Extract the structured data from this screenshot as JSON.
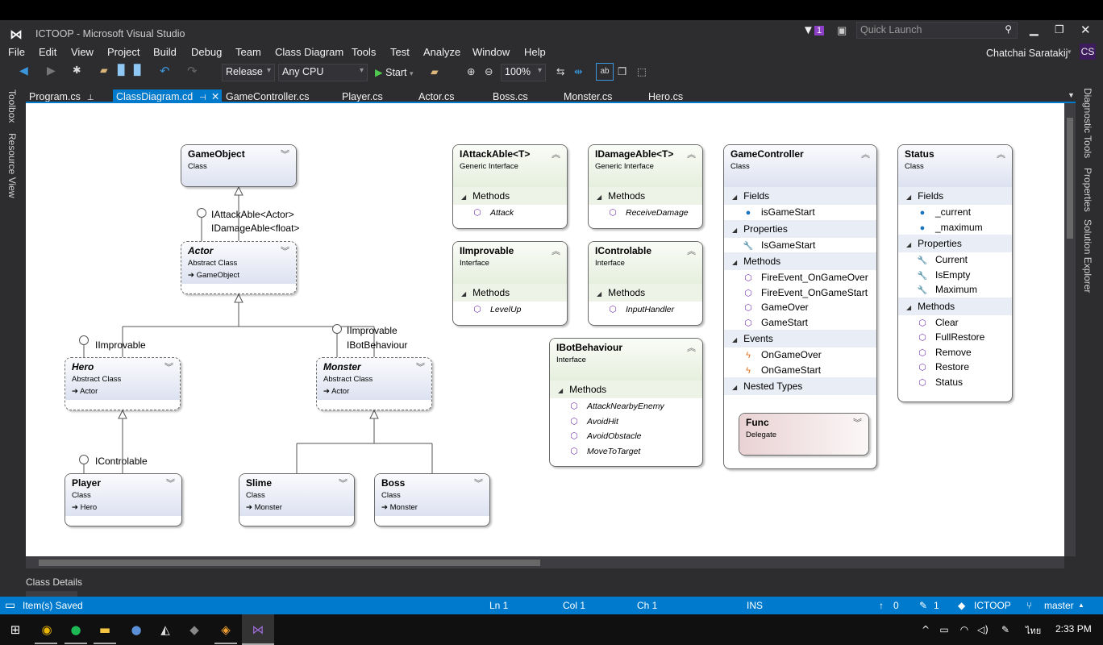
{
  "window": {
    "title": "ICTOOP - Microsoft Visual Studio",
    "notification_count": "1",
    "quick_launch_placeholder": "Quick Launch",
    "user_name": "Chatchai Saratakij",
    "user_initials": "CS"
  },
  "menu": [
    "File",
    "Edit",
    "View",
    "Project",
    "Build",
    "Debug",
    "Team",
    "Class Diagram",
    "Tools",
    "Test",
    "Analyze",
    "Window",
    "Help"
  ],
  "toolbar": {
    "configuration": "Release",
    "platform": "Any CPU",
    "start_label": "Start",
    "zoom": "100%"
  },
  "tabs": [
    {
      "label": "Program.cs",
      "pinned": true
    },
    {
      "label": "ClassDiagram.cd",
      "active": true
    },
    {
      "label": "GameController.cs"
    },
    {
      "label": "Player.cs"
    },
    {
      "label": "Actor.cs"
    },
    {
      "label": "Boss.cs"
    },
    {
      "label": "Monster.cs"
    },
    {
      "label": "Hero.cs"
    }
  ],
  "left_panels": [
    "Toolbox",
    "Resource View"
  ],
  "right_panels": [
    "Diagnostic Tools",
    "Properties",
    "Solution Explorer"
  ],
  "diagram": {
    "classes": [
      {
        "name": "GameObject",
        "kind": "Class",
        "style": "class",
        "chevron": "down"
      },
      {
        "name": "Actor",
        "kind": "Abstract Class",
        "base": "GameObject",
        "style": "abstract",
        "chevron": "down"
      },
      {
        "name": "Hero",
        "kind": "Abstract Class",
        "base": "Actor",
        "style": "abstract",
        "chevron": "down"
      },
      {
        "name": "Monster",
        "kind": "Abstract Class",
        "base": "Actor",
        "style": "abstract",
        "chevron": "down"
      },
      {
        "name": "Player",
        "kind": "Class",
        "base": "Hero",
        "style": "class",
        "chevron": "down"
      },
      {
        "name": "Slime",
        "kind": "Class",
        "base": "Monster",
        "style": "class",
        "chevron": "down"
      },
      {
        "name": "Boss",
        "kind": "Class",
        "base": "Monster",
        "style": "class",
        "chevron": "down"
      },
      {
        "name": "IAttackAble<T>",
        "kind": "Generic Interface",
        "style": "interface",
        "chevron": "up",
        "sections": [
          {
            "title": "Methods",
            "items": [
              {
                "name": "Attack",
                "icon": "method"
              }
            ]
          }
        ]
      },
      {
        "name": "IDamageAble<T>",
        "kind": "Generic Interface",
        "style": "interface",
        "chevron": "up",
        "sections": [
          {
            "title": "Methods",
            "items": [
              {
                "name": "ReceiveDamage",
                "icon": "method"
              }
            ]
          }
        ]
      },
      {
        "name": "IImprovable",
        "kind": "Interface",
        "style": "interface",
        "chevron": "up",
        "sections": [
          {
            "title": "Methods",
            "items": [
              {
                "name": "LevelUp",
                "icon": "method"
              }
            ]
          }
        ]
      },
      {
        "name": "IControlable",
        "kind": "Interface",
        "style": "interface",
        "chevron": "up",
        "sections": [
          {
            "title": "Methods",
            "items": [
              {
                "name": "InputHandler",
                "icon": "method"
              }
            ]
          }
        ]
      },
      {
        "name": "IBotBehaviour",
        "kind": "Interface",
        "style": "interface",
        "chevron": "up",
        "sections": [
          {
            "title": "Methods",
            "items": [
              {
                "name": "AttackNearbyEnemy",
                "icon": "method"
              },
              {
                "name": "AvoidHit",
                "icon": "method"
              },
              {
                "name": "AvoidObstacle",
                "icon": "method"
              },
              {
                "name": "MoveToTarget",
                "icon": "method"
              }
            ]
          }
        ]
      },
      {
        "name": "GameController",
        "kind": "Class",
        "style": "class",
        "chevron": "up",
        "sections": [
          {
            "title": "Fields",
            "items": [
              {
                "name": "isGameStart",
                "icon": "field"
              }
            ]
          },
          {
            "title": "Properties",
            "items": [
              {
                "name": "IsGameStart",
                "icon": "property"
              }
            ]
          },
          {
            "title": "Methods",
            "items": [
              {
                "name": "FireEvent_OnGameOver",
                "icon": "method"
              },
              {
                "name": "FireEvent_OnGameStart",
                "icon": "method"
              },
              {
                "name": "GameOver",
                "icon": "method"
              },
              {
                "name": "GameStart",
                "icon": "method"
              }
            ]
          },
          {
            "title": "Events",
            "items": [
              {
                "name": "OnGameOver",
                "icon": "event"
              },
              {
                "name": "OnGameStart",
                "icon": "event"
              }
            ]
          },
          {
            "title": "Nested Types",
            "items": []
          }
        ]
      },
      {
        "name": "Status",
        "kind": "Class",
        "style": "class",
        "chevron": "up",
        "sections": [
          {
            "title": "Fields",
            "items": [
              {
                "name": "_current",
                "icon": "field"
              },
              {
                "name": "_maximum",
                "icon": "field"
              }
            ]
          },
          {
            "title": "Properties",
            "items": [
              {
                "name": "Current",
                "icon": "property"
              },
              {
                "name": "IsEmpty",
                "icon": "property"
              },
              {
                "name": "Maximum",
                "icon": "property"
              }
            ]
          },
          {
            "title": "Methods",
            "items": [
              {
                "name": "Clear",
                "icon": "method"
              },
              {
                "name": "FullRestore",
                "icon": "method"
              },
              {
                "name": "Remove",
                "icon": "method"
              },
              {
                "name": "Restore",
                "icon": "method"
              },
              {
                "name": "Status",
                "icon": "method"
              }
            ]
          }
        ]
      },
      {
        "name": "Func",
        "kind": "Delegate",
        "style": "delegate",
        "chevron": "down"
      }
    ],
    "interface_labels": {
      "actor_1": "IAttackAble<Actor>",
      "actor_2": "IDamageAble<float>",
      "hero": "IImprovable",
      "monster_1": "IImprovable",
      "monster_2": "IBotBehaviour",
      "player": "IControlable"
    }
  },
  "class_details_label": "Class Details",
  "status_bar": {
    "message": "Item(s) Saved",
    "line": "Ln 1",
    "col": "Col 1",
    "ch": "Ch 1",
    "mode": "INS",
    "pushes": "0",
    "changes": "1",
    "repo": "ICTOOP",
    "branch": "master"
  },
  "taskbar": {
    "time": "2:33 PM",
    "language": "ไทย"
  },
  "colors": {
    "accent": "#007acc",
    "background": "#2d2d30",
    "vs_purple": "#68217a"
  }
}
